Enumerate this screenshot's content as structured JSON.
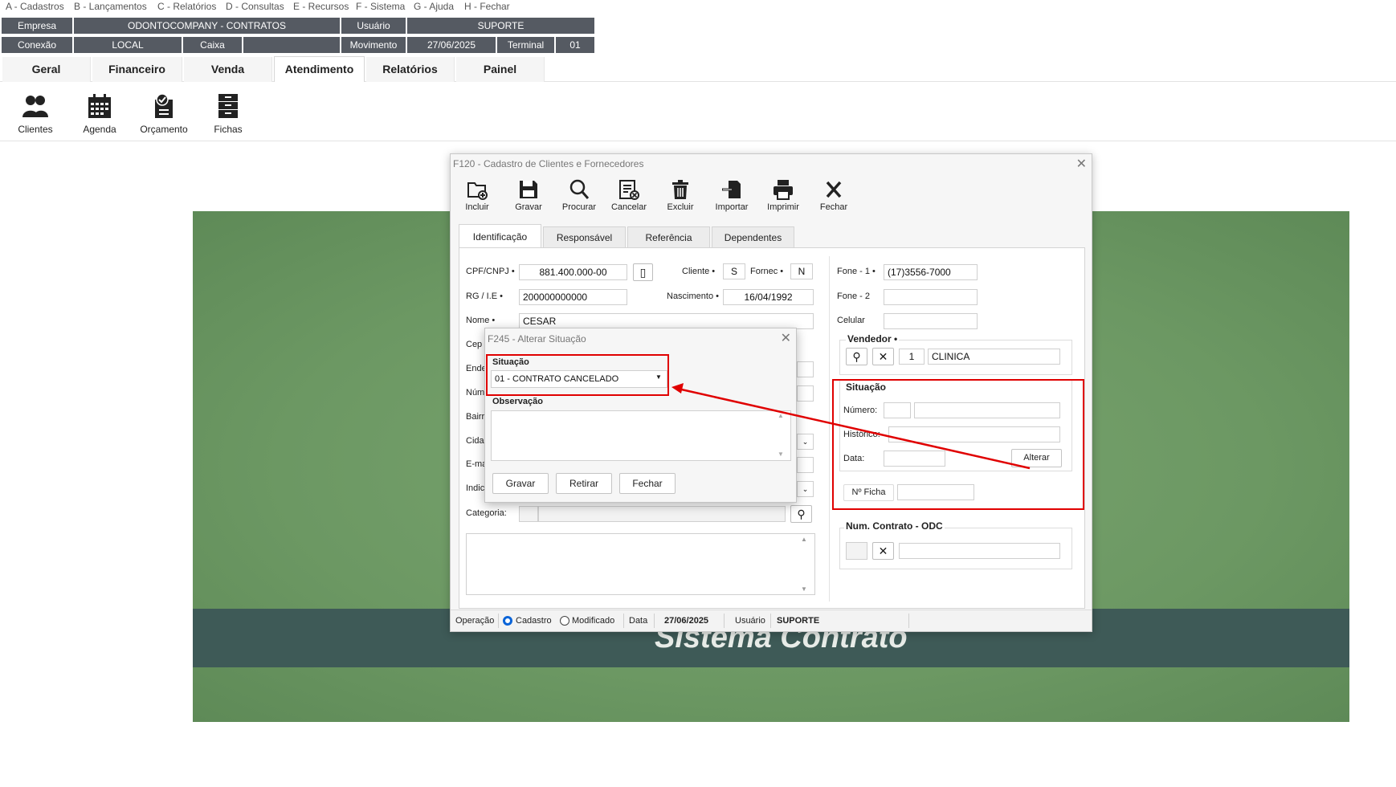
{
  "menu": [
    "A - Cadastros",
    "B - Lançamentos",
    "C - Relatórios",
    "D - Consultas",
    "E - Recursos",
    "F - Sistema",
    "G - Ajuda",
    "H - Fechar"
  ],
  "header": {
    "empresa_label": "Empresa",
    "empresa_value": "ODONTOCOMPANY - CONTRATOS",
    "usuario_label": "Usuário",
    "usuario_value": "SUPORTE",
    "conexao_label": "Conexão",
    "conexao_value": "LOCAL",
    "caixa_label": "Caixa",
    "caixa_value": "",
    "movimento_label": "Movimento",
    "movimento_value": "27/06/2025",
    "terminal_label": "Terminal",
    "terminal_value": "01"
  },
  "main_tabs": [
    "Geral",
    "Financeiro",
    "Venda",
    "Atendimento",
    "Relatórios",
    "Painel"
  ],
  "main_tabs_active": "Atendimento",
  "ribbon": [
    {
      "label": "Clientes",
      "icon": "users-icon"
    },
    {
      "label": "Agenda",
      "icon": "calendar-icon"
    },
    {
      "label": "Orçamento",
      "icon": "budget-icon"
    },
    {
      "label": "Fichas",
      "icon": "file-cabinet-icon"
    }
  ],
  "banner": {
    "title": "Sistema Contrato"
  },
  "window": {
    "title": "F120 - Cadastro de Clientes e Fornecedores",
    "toolbar": [
      "Incluir",
      "Gravar",
      "Procurar",
      "Cancelar",
      "Excluir",
      "Importar",
      "Imprimir",
      "Fechar"
    ],
    "tabs": [
      "Identificação",
      "Responsável",
      "Referência",
      "Dependentes"
    ],
    "tabs_active": "Identificação",
    "form": {
      "cpf_label": "CPF/CNPJ •",
      "cpf_value": "881.400.000-00",
      "cliente_label": "Cliente •",
      "cliente_value": "S",
      "fornec_label": "Fornec •",
      "fornec_value": "N",
      "rg_label": "RG / I.E •",
      "rg_value": "200000000000",
      "nascimento_label": "Nascimento •",
      "nascimento_value": "16/04/1992",
      "nome_label": "Nome •",
      "nome_value": "CESAR",
      "cep_label": "Cep",
      "ende_label": "Ende",
      "num_label": "Núm",
      "bairro_label": "Bairr",
      "cidade_label": "Cida",
      "email_label": "E-ma",
      "indic_label": "Indic",
      "categoria_label": "Categoria:"
    },
    "right": {
      "fone1_label": "Fone - 1 •",
      "fone1_value": "(17)3556-7000",
      "fone2_label": "Fone - 2",
      "fone2_value": "",
      "celular_label": "Celular",
      "celular_value": "",
      "vendedor_title": "Vendedor •",
      "vendedor_code": "1",
      "vendedor_name": "CLINICA",
      "situacao_title": "Situação",
      "numero_label": "Número:",
      "historico_label": "Histórico:",
      "data_label": "Data:",
      "alterar_label": "Alterar",
      "ficha_label": "Nº Ficha",
      "contrato_title": "Num. Contrato - ODC"
    },
    "status": {
      "operacao_label": "Operação",
      "cadastro_label": "Cadastro",
      "modificado_label": "Modificado",
      "data_label": "Data",
      "data_value": "27/06/2025",
      "usuario_label": "Usuário",
      "usuario_value": "SUPORTE"
    }
  },
  "dialog": {
    "title": "F245 - Alterar Situação",
    "situacao_label": "Situação",
    "situacao_value": "01 - CONTRATO CANCELADO",
    "observacao_label": "Observação",
    "buttons": [
      "Gravar",
      "Retirar",
      "Fechar"
    ]
  },
  "colors": {
    "header_bg": "#555a62",
    "annotation_red": "#e00000",
    "banner_green": "#6c9863",
    "banner_strip": "#3e5a57"
  }
}
